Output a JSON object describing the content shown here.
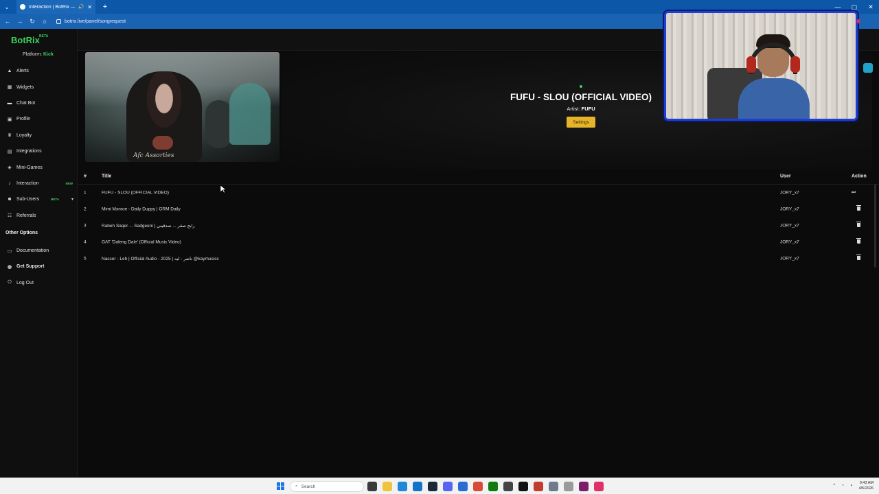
{
  "browser": {
    "tab_title": "Interaction | BotRix — Clou",
    "new_tab": "+",
    "url": "botrix.live/panel/songrequest",
    "window_controls": [
      "—",
      "▢",
      "✕"
    ]
  },
  "sidebar": {
    "logo": "BotRix",
    "logo_badge": "BETA",
    "platform_label": "Platform:",
    "platform_value": "Kick",
    "items": [
      {
        "label": "Alerts",
        "icon": "bell-icon"
      },
      {
        "label": "Widgets",
        "icon": "widgets-icon"
      },
      {
        "label": "Chat Bot",
        "icon": "chat-icon"
      },
      {
        "label": "Profile",
        "icon": "profile-icon"
      },
      {
        "label": "Loyalty",
        "icon": "trophy-icon"
      },
      {
        "label": "Integrations",
        "icon": "integrations-icon"
      },
      {
        "label": "Mini-Games",
        "icon": "gamepad-icon"
      },
      {
        "label": "Interaction",
        "icon": "interaction-icon",
        "badge": "NEW"
      },
      {
        "label": "Sub-Users",
        "icon": "users-icon",
        "badge": "BETA"
      },
      {
        "label": "Referrals",
        "icon": "referrals-icon"
      }
    ],
    "other_heading": "Other Options",
    "other_items": [
      {
        "label": "Documentation",
        "icon": "document-icon"
      },
      {
        "label": "Get Support",
        "icon": "support-icon"
      },
      {
        "label": "Log Out",
        "icon": "logout-icon"
      }
    ]
  },
  "now_playing": {
    "title": "FUFU - SLOU (OFFICIAL VIDEO)",
    "artist_label": "Artist:",
    "artist": "FUFU",
    "settings_label": "Settings",
    "thumbnail_text": "Afc Assorties"
  },
  "queue": {
    "columns": {
      "num": "#",
      "title": "Title",
      "user": "User",
      "action": "Action"
    },
    "rows": [
      {
        "num": "1",
        "title": "FUFU - SLOU (OFFICIAL VIDEO)",
        "user": "JORY_x7",
        "action": "skip-icon"
      },
      {
        "num": "2",
        "title": "Mimi Mxnroe - Daily Duppy | GRM Daily",
        "user": "JORY_x7",
        "action": "trash-icon"
      },
      {
        "num": "3",
        "title": "Rabeh Saqer ... Sadgeeni | رابح صقر ... صدقيني",
        "user": "JORY_x7",
        "action": "trash-icon"
      },
      {
        "num": "4",
        "title": "GAT 'Daleng Dale' (Official Music Video)",
        "user": "JORY_x7",
        "action": "trash-icon"
      },
      {
        "num": "5",
        "title": "Nasser - Leh | Official Audio - 2025 | ناصر - ليه @kaymusicc",
        "user": "JORY_x7",
        "action": "trash-icon"
      }
    ]
  },
  "taskbar": {
    "search_placeholder": "Search",
    "time": "9:43 AM",
    "date": "4/5/2026"
  },
  "colors": {
    "accent_green": "#3cd15a",
    "settings_yellow": "#e5b42a",
    "browser_blue": "#1a63b3",
    "webcam_border": "#1f3fd1"
  }
}
